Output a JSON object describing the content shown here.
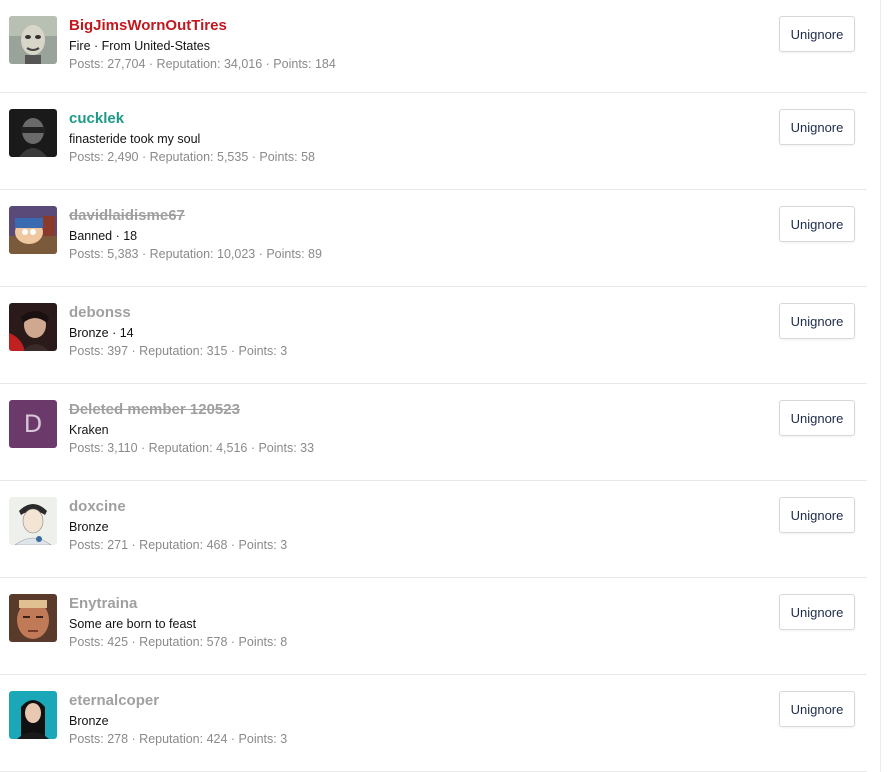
{
  "members": [
    {
      "username": "BigJimsWornOutTires",
      "style": "red",
      "subtitle": "Fire · From United-States",
      "stats": "Posts: 27,704 · Reputation: 34,016 · Points: 184",
      "button": "Unignore",
      "avatar": "skull-mask-avatar"
    },
    {
      "username": "cucklek",
      "style": "teal",
      "subtitle": "finasteride took my soul",
      "stats": "Posts: 2,490 · Reputation: 5,535 · Points: 58",
      "button": "Unignore",
      "avatar": "dark-portrait-avatar"
    },
    {
      "username": "davidlaidisme67",
      "style": "strike",
      "subtitle": "Banned · 18",
      "stats": "Posts: 5,383 · Reputation: 10,023 · Points: 89",
      "button": "Unignore",
      "avatar": "cartoon-avatar"
    },
    {
      "username": "debonss",
      "style": "gray",
      "subtitle": "Bronze · 14",
      "stats": "Posts: 397 · Reputation: 315 · Points: 3",
      "button": "Unignore",
      "avatar": "red-portrait-avatar"
    },
    {
      "username": "Deleted member 120523",
      "style": "strike",
      "subtitle": "Kraken",
      "stats": "Posts: 3,110 · Reputation: 4,516 · Points: 33",
      "button": "Unignore",
      "avatar": "letter-avatar",
      "avatar_letter": "D"
    },
    {
      "username": "doxcine",
      "style": "gray",
      "subtitle": "Bronze",
      "stats": "Posts: 271 · Reputation: 468 · Points: 3",
      "button": "Unignore",
      "avatar": "sketch-face-avatar"
    },
    {
      "username": "Enytraina",
      "style": "gray",
      "subtitle": "Some are born to feast",
      "stats": "Posts: 425 · Reputation: 578 · Points: 8",
      "button": "Unignore",
      "avatar": "face-avatar"
    },
    {
      "username": "eternalcoper",
      "style": "gray",
      "subtitle": "Bronze",
      "stats": "Posts: 278 · Reputation: 424 · Points: 3",
      "button": "Unignore",
      "avatar": "teal-portrait-avatar"
    }
  ]
}
